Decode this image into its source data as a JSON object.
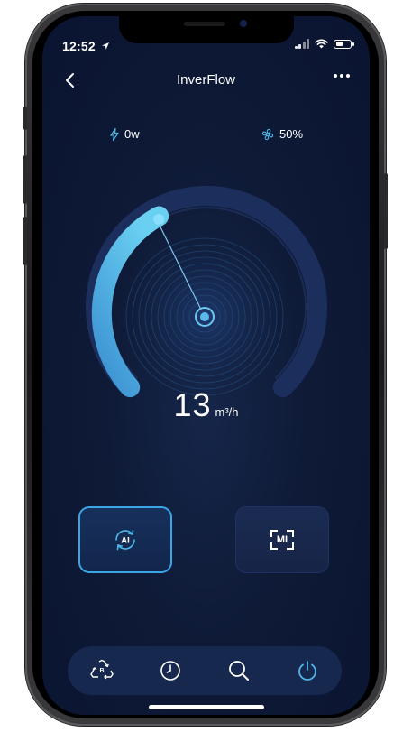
{
  "status_bar": {
    "time": "12:52",
    "icons": [
      "location-arrow-icon",
      "signal-icon",
      "wifi-icon",
      "battery-icon"
    ]
  },
  "header": {
    "title": "InverFlow",
    "back_icon": "chevron-left-icon",
    "more_icon": "more-dots-icon"
  },
  "stats": {
    "power": {
      "icon": "lightning-icon",
      "value": "0w"
    },
    "speed": {
      "icon": "fan-icon",
      "value": "50%"
    }
  },
  "gauge": {
    "flow_value": "13",
    "flow_unit": "m³/h",
    "fill_fraction": 0.3,
    "accent": "#4fb7e8",
    "track": "#1c2f5c"
  },
  "modes": {
    "ai_label": "AI",
    "mi_label": "MI",
    "ai_selected": true
  },
  "tabbar": {
    "items": [
      {
        "icon": "recycle-b-icon",
        "label": "B",
        "active": false
      },
      {
        "icon": "clock-icon",
        "active": false
      },
      {
        "icon": "search-icon",
        "active": false
      },
      {
        "icon": "power-icon",
        "active": true
      }
    ]
  },
  "colors": {
    "background": "#0e1a36",
    "accent": "#3aa6e6",
    "text": "#ffffff"
  }
}
